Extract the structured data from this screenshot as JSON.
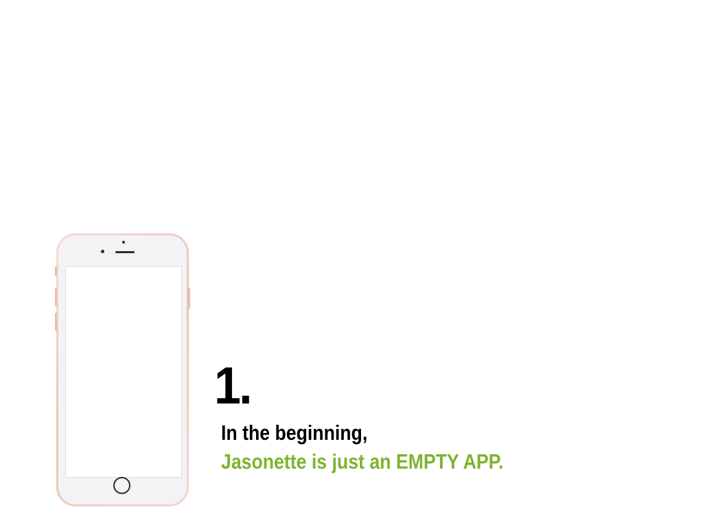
{
  "step": {
    "number": "1."
  },
  "caption": {
    "line1": "In the beginning,",
    "line2": "Jasonette is just an EMPTY APP."
  },
  "colors": {
    "background": "#ffffff",
    "number_text": "#000000",
    "line1_text": "#000000",
    "line2_text": "#7cb430",
    "phone_frame": "#ecc2b6",
    "phone_face": "#f3f3f5",
    "screen": "#ffffff"
  },
  "icons": {
    "device": "smartphone-icon",
    "home": "home-button-icon",
    "speaker": "speaker-icon",
    "camera": "camera-icon"
  }
}
